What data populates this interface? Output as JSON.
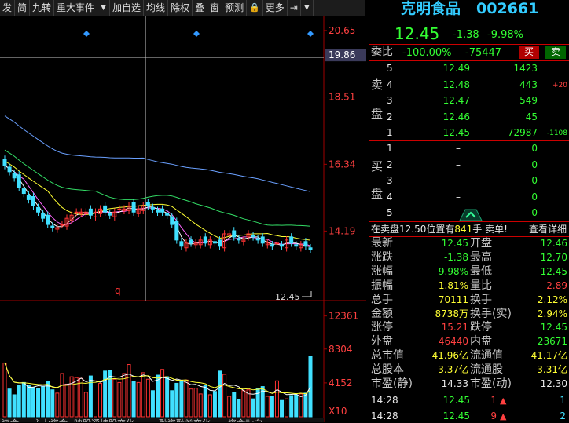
{
  "toolbar": {
    "items": [
      "发",
      "简",
      "九转",
      "重大事件",
      "▼",
      "加自选",
      "均线",
      "除权",
      "叠",
      "窗",
      "预测",
      "🔒",
      "更多",
      "⇥",
      "▼"
    ]
  },
  "chart": {
    "price_ticks": [
      "20.65",
      "19.86",
      "18.51",
      "16.34",
      "14.19"
    ],
    "highlight_price": "19.86",
    "last_price_label": "12.45",
    "low_marker": "q",
    "volume_ticks": [
      "12361",
      "8304",
      "4152",
      "X10"
    ],
    "bottom_tabs": [
      "资金",
      "主力资金",
      "映股通持股变化",
      "融资融券变化",
      "资金动向"
    ]
  },
  "chart_data": {
    "type": "candlestick",
    "ylim": [
      12.0,
      20.9
    ],
    "closes": [
      16.3,
      16.1,
      15.9,
      15.6,
      15.4,
      15.2,
      15.0,
      14.8,
      14.6,
      14.4,
      14.3,
      14.3,
      14.4,
      14.6,
      14.7,
      14.8,
      14.8,
      14.8,
      14.7,
      14.8,
      14.9,
      14.8,
      14.7,
      14.8,
      14.9,
      14.9,
      15.0,
      14.8,
      14.9,
      15.0,
      15.0,
      14.9,
      14.8,
      14.8,
      14.7,
      14.4,
      13.9,
      13.7,
      13.8,
      13.8,
      13.8,
      13.9,
      13.8,
      13.9,
      13.8,
      13.7,
      14.1,
      14.1,
      14.0,
      13.9,
      13.9,
      14.1,
      14.0,
      13.9,
      13.8,
      13.8,
      13.7,
      13.8,
      13.7,
      13.9,
      13.8,
      13.7,
      13.75,
      13.7,
      13.6
    ],
    "volumes": [
      6600,
      3400,
      2700,
      3900,
      4200,
      3800,
      3600,
      3500,
      3700,
      4300,
      3300,
      2900,
      5300,
      4000,
      4900,
      4800,
      4700,
      3000,
      5000,
      4400,
      4100,
      5600,
      5700,
      4600,
      4200,
      5300,
      6400,
      4300,
      4200,
      5400,
      4600,
      3200,
      5100,
      5800,
      4900,
      3200,
      4100,
      4400,
      4500,
      3400,
      3500,
      2800,
      3800,
      2700,
      3100,
      5600,
      5200,
      2500,
      3000,
      2100,
      3200,
      3300,
      2200,
      3500,
      3700,
      2500,
      2500,
      4400,
      2000,
      2200,
      2600,
      2700,
      2800,
      2900,
      7400
    ]
  },
  "header": {
    "stock_name": "克明食品",
    "stock_code": "002661",
    "price": "12.45",
    "change": "-1.38",
    "change_pct": "-9.98%"
  },
  "weibi": {
    "label": "委比",
    "pct": "-100.00%",
    "diff": "-75447",
    "buy_btn": "买",
    "sell_btn": "卖"
  },
  "sell_label": [
    "卖",
    "盘"
  ],
  "buy_label": [
    "买",
    "盘"
  ],
  "sell_orders": [
    {
      "level": "5",
      "price": "12.49",
      "vol": "1423",
      "delta": ""
    },
    {
      "level": "4",
      "price": "12.48",
      "vol": "443",
      "delta": "+20"
    },
    {
      "level": "3",
      "price": "12.47",
      "vol": "549",
      "delta": ""
    },
    {
      "level": "2",
      "price": "12.46",
      "vol": "45",
      "delta": ""
    },
    {
      "level": "1",
      "price": "12.45",
      "vol": "72987",
      "delta": "-1108"
    }
  ],
  "buy_orders": [
    {
      "level": "1",
      "price": "–",
      "vol": "0"
    },
    {
      "level": "2",
      "price": "–",
      "vol": "0"
    },
    {
      "level": "3",
      "price": "–",
      "vol": "0"
    },
    {
      "level": "4",
      "price": "–",
      "vol": "0"
    },
    {
      "level": "5",
      "price": "–",
      "vol": "0"
    }
  ],
  "status": {
    "text1": "在卖盘",
    "price": "12.50",
    "text2": "位置有",
    "vol": "841",
    "text3": "手 卖单!",
    "detail": "查看详细"
  },
  "quote": [
    {
      "l1": "最新",
      "v1": "12.45",
      "c1": "g",
      "l2": "开盘",
      "v2": "12.46",
      "c2": "g"
    },
    {
      "l1": "涨跌",
      "v1": "-1.38",
      "c1": "g",
      "l2": "最高",
      "v2": "12.70",
      "c2": "g"
    },
    {
      "l1": "涨幅",
      "v1": "-9.98%",
      "c1": "g",
      "l2": "最低",
      "v2": "12.45",
      "c2": "g"
    },
    {
      "l1": "振幅",
      "v1": "1.81%",
      "c1": "y",
      "l2": "量比",
      "v2": "2.89",
      "c2": "r"
    },
    {
      "l1": "总手",
      "v1": "70111",
      "c1": "y",
      "l2": "换手",
      "v2": "2.12%",
      "c2": "y"
    },
    {
      "l1": "金额",
      "v1": "8738万",
      "c1": "y",
      "l2": "换手(实)",
      "v2": "2.94%",
      "c2": "y"
    },
    {
      "l1": "涨停",
      "v1": "15.21",
      "c1": "r",
      "l2": "跌停",
      "v2": "12.45",
      "c2": "g"
    },
    {
      "l1": "外盘",
      "v1": "46440",
      "c1": "r",
      "l2": "内盘",
      "v2": "23671",
      "c2": "g"
    },
    {
      "l1": "总市值",
      "v1": "41.96亿",
      "c1": "y",
      "l2": "流通值",
      "v2": "41.17亿",
      "c2": "y"
    },
    {
      "l1": "总股本",
      "v1": "3.37亿",
      "c1": "y",
      "l2": "流通股",
      "v2": "3.31亿",
      "c2": "y"
    },
    {
      "l1": "市盈(静)",
      "v1": "14.33",
      "c1": "w",
      "l2": "市盈(动)",
      "v2": "12.30",
      "c2": "w"
    }
  ],
  "ticks": [
    {
      "time": "14:28",
      "price": "12.45",
      "vol": "1",
      "arrow": "▲",
      "num": "1"
    },
    {
      "time": "14:28",
      "price": "12.45",
      "vol": "9",
      "arrow": "▲",
      "num": "2"
    }
  ]
}
